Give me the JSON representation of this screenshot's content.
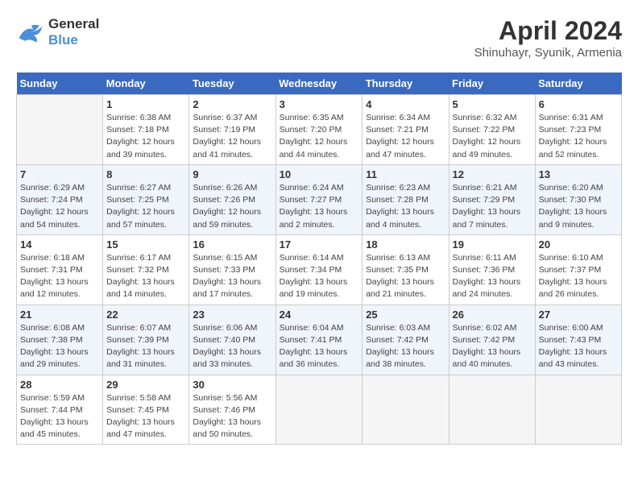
{
  "header": {
    "logo_line1": "General",
    "logo_line2": "Blue",
    "month_year": "April 2024",
    "location": "Shinuhayr, Syunik, Armenia"
  },
  "columns": [
    "Sunday",
    "Monday",
    "Tuesday",
    "Wednesday",
    "Thursday",
    "Friday",
    "Saturday"
  ],
  "weeks": [
    [
      {
        "day": "",
        "empty": true
      },
      {
        "day": "1",
        "sunrise": "6:38 AM",
        "sunset": "7:18 PM",
        "daylight": "12 hours and 39 minutes."
      },
      {
        "day": "2",
        "sunrise": "6:37 AM",
        "sunset": "7:19 PM",
        "daylight": "12 hours and 41 minutes."
      },
      {
        "day": "3",
        "sunrise": "6:35 AM",
        "sunset": "7:20 PM",
        "daylight": "12 hours and 44 minutes."
      },
      {
        "day": "4",
        "sunrise": "6:34 AM",
        "sunset": "7:21 PM",
        "daylight": "12 hours and 47 minutes."
      },
      {
        "day": "5",
        "sunrise": "6:32 AM",
        "sunset": "7:22 PM",
        "daylight": "12 hours and 49 minutes."
      },
      {
        "day": "6",
        "sunrise": "6:31 AM",
        "sunset": "7:23 PM",
        "daylight": "12 hours and 52 minutes."
      }
    ],
    [
      {
        "day": "7",
        "sunrise": "6:29 AM",
        "sunset": "7:24 PM",
        "daylight": "12 hours and 54 minutes."
      },
      {
        "day": "8",
        "sunrise": "6:27 AM",
        "sunset": "7:25 PM",
        "daylight": "12 hours and 57 minutes."
      },
      {
        "day": "9",
        "sunrise": "6:26 AM",
        "sunset": "7:26 PM",
        "daylight": "12 hours and 59 minutes."
      },
      {
        "day": "10",
        "sunrise": "6:24 AM",
        "sunset": "7:27 PM",
        "daylight": "13 hours and 2 minutes."
      },
      {
        "day": "11",
        "sunrise": "6:23 AM",
        "sunset": "7:28 PM",
        "daylight": "13 hours and 4 minutes."
      },
      {
        "day": "12",
        "sunrise": "6:21 AM",
        "sunset": "7:29 PM",
        "daylight": "13 hours and 7 minutes."
      },
      {
        "day": "13",
        "sunrise": "6:20 AM",
        "sunset": "7:30 PM",
        "daylight": "13 hours and 9 minutes."
      }
    ],
    [
      {
        "day": "14",
        "sunrise": "6:18 AM",
        "sunset": "7:31 PM",
        "daylight": "13 hours and 12 minutes."
      },
      {
        "day": "15",
        "sunrise": "6:17 AM",
        "sunset": "7:32 PM",
        "daylight": "13 hours and 14 minutes."
      },
      {
        "day": "16",
        "sunrise": "6:15 AM",
        "sunset": "7:33 PM",
        "daylight": "13 hours and 17 minutes."
      },
      {
        "day": "17",
        "sunrise": "6:14 AM",
        "sunset": "7:34 PM",
        "daylight": "13 hours and 19 minutes."
      },
      {
        "day": "18",
        "sunrise": "6:13 AM",
        "sunset": "7:35 PM",
        "daylight": "13 hours and 21 minutes."
      },
      {
        "day": "19",
        "sunrise": "6:11 AM",
        "sunset": "7:36 PM",
        "daylight": "13 hours and 24 minutes."
      },
      {
        "day": "20",
        "sunrise": "6:10 AM",
        "sunset": "7:37 PM",
        "daylight": "13 hours and 26 minutes."
      }
    ],
    [
      {
        "day": "21",
        "sunrise": "6:08 AM",
        "sunset": "7:38 PM",
        "daylight": "13 hours and 29 minutes."
      },
      {
        "day": "22",
        "sunrise": "6:07 AM",
        "sunset": "7:39 PM",
        "daylight": "13 hours and 31 minutes."
      },
      {
        "day": "23",
        "sunrise": "6:06 AM",
        "sunset": "7:40 PM",
        "daylight": "13 hours and 33 minutes."
      },
      {
        "day": "24",
        "sunrise": "6:04 AM",
        "sunset": "7:41 PM",
        "daylight": "13 hours and 36 minutes."
      },
      {
        "day": "25",
        "sunrise": "6:03 AM",
        "sunset": "7:42 PM",
        "daylight": "13 hours and 38 minutes."
      },
      {
        "day": "26",
        "sunrise": "6:02 AM",
        "sunset": "7:42 PM",
        "daylight": "13 hours and 40 minutes."
      },
      {
        "day": "27",
        "sunrise": "6:00 AM",
        "sunset": "7:43 PM",
        "daylight": "13 hours and 43 minutes."
      }
    ],
    [
      {
        "day": "28",
        "sunrise": "5:59 AM",
        "sunset": "7:44 PM",
        "daylight": "13 hours and 45 minutes."
      },
      {
        "day": "29",
        "sunrise": "5:58 AM",
        "sunset": "7:45 PM",
        "daylight": "13 hours and 47 minutes."
      },
      {
        "day": "30",
        "sunrise": "5:56 AM",
        "sunset": "7:46 PM",
        "daylight": "13 hours and 50 minutes."
      },
      {
        "day": "",
        "empty": true
      },
      {
        "day": "",
        "empty": true
      },
      {
        "day": "",
        "empty": true
      },
      {
        "day": "",
        "empty": true
      }
    ]
  ]
}
